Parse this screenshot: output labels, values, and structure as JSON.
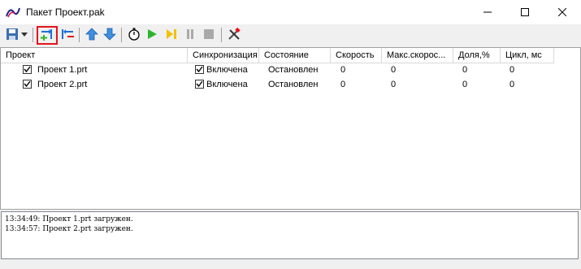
{
  "window": {
    "title": "Пакет  Проект.pak"
  },
  "toolbar": {
    "items": [
      {
        "icon": "save-icon"
      },
      {
        "icon": "dropdown-arrow-icon"
      },
      {
        "icon": "add-project-icon",
        "selected": true
      },
      {
        "icon": "remove-project-icon"
      },
      {
        "icon": "move-up-icon"
      },
      {
        "icon": "move-down-icon"
      },
      {
        "icon": "stopwatch-icon"
      },
      {
        "icon": "play-icon"
      },
      {
        "icon": "step-icon"
      },
      {
        "icon": "pause-icon"
      },
      {
        "icon": "stop-icon"
      },
      {
        "icon": "tools-icon"
      }
    ]
  },
  "table": {
    "columns": [
      "Проект",
      "Синхронизация",
      "Состояние",
      "Скорость",
      "Макс.скорос...",
      "Доля,%",
      "Цикл, мс"
    ],
    "rows": [
      {
        "project": "Проект 1.prt",
        "checked": true,
        "sync": "Включена",
        "sync_checked": true,
        "state": "Остановлен",
        "speed": "0",
        "max_speed": "0",
        "share": "0",
        "cycle": "0"
      },
      {
        "project": "Проект 2.prt",
        "checked": true,
        "sync": "Включена",
        "sync_checked": true,
        "state": "Остановлен",
        "speed": "0",
        "max_speed": "0",
        "share": "0",
        "cycle": "0"
      }
    ]
  },
  "log": {
    "lines": [
      "13:34:49: Проект 1.prt загружен.",
      "13:34:57: Проект 2.prt загружен."
    ]
  },
  "colors": {
    "accent_blue": "#1e6fd6",
    "play_green": "#2cb52c",
    "step_yellow": "#f2c200",
    "selection_red": "#e4141b"
  }
}
